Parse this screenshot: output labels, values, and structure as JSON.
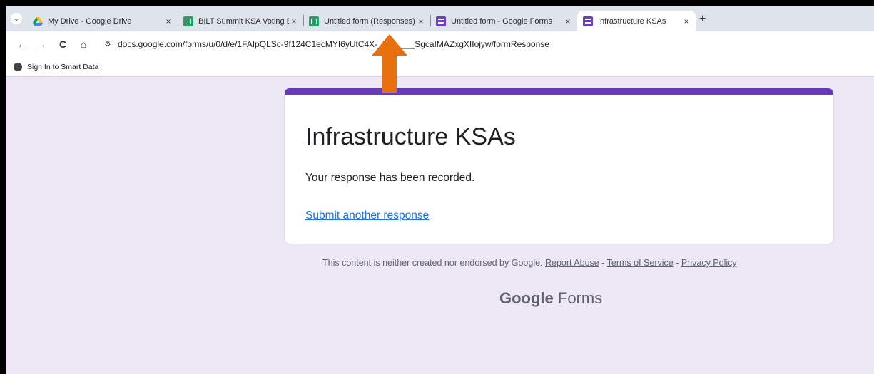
{
  "tabs": [
    {
      "title": "My Drive - Google Drive",
      "icon": "google-drive-icon",
      "close": "×"
    },
    {
      "title": "BILT Summit KSA Voting Examp",
      "icon": "google-sheets-icon",
      "close": "×"
    },
    {
      "title": "Untitled form (Responses) - Go",
      "icon": "google-sheets-icon",
      "close": "×"
    },
    {
      "title": "Untitled form - Google Forms",
      "icon": "google-forms-icon",
      "close": "×"
    },
    {
      "title": "Infrastructure KSAs",
      "icon": "google-forms-icon",
      "close": "×"
    }
  ],
  "tab_menu": "⌄",
  "new_tab": "+",
  "toolbar": {
    "back": "←",
    "forward": "→",
    "reload": "C",
    "home": "⌂",
    "site_info": "⚙",
    "url": "docs.google.com/forms/u/0/d/e/1FAIpQLSc-9f124C1ecMYI6yUtC4X-_Dm____SgcaIMAZxgXIIojyw/formResponse"
  },
  "bookmarks": [
    {
      "label": "Sign In to Smart Data",
      "icon": "globe-icon"
    }
  ],
  "form": {
    "title": "Infrastructure KSAs",
    "confirmation": "Your response has been recorded.",
    "submit_another": "Submit another response"
  },
  "footer": {
    "text": "This content is neither created nor endorsed by Google.",
    "report_abuse": "Report Abuse",
    "sep1": " - ",
    "terms": "Terms of Service",
    "sep2": " - ",
    "privacy": "Privacy Policy"
  },
  "branding": {
    "google": "Google",
    "forms": "Forms"
  },
  "colors": {
    "accent": "#673ab7",
    "background": "#ede7f6",
    "link": "#1a73e8",
    "annotation_arrow": "#e8700f"
  }
}
